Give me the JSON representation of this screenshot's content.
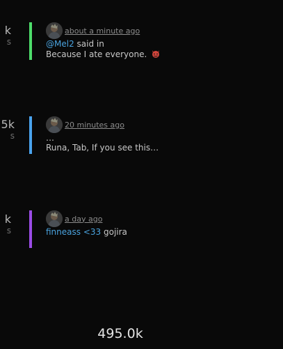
{
  "edge_stats": [
    {
      "value": "k",
      "sub": "s"
    },
    {
      "value": "5k",
      "sub": "s"
    },
    {
      "value": "k",
      "sub": "s"
    }
  ],
  "activities": [
    {
      "accent_color": "#4ddc6a",
      "time": "about a minute ago",
      "mention": "@Mel2",
      "after_mention": "said in",
      "text": "Because I ate everyone.",
      "emoji_icon": "devil-face-icon"
    },
    {
      "accent_color": "#4aa3ee",
      "time": "20 minutes ago",
      "ellipsis": "…",
      "text": "Runa, Tab, If you see this…"
    },
    {
      "accent_color": "#9b4ce6",
      "time": "a day ago",
      "link_text": "finneass <33",
      "text": "gojira"
    }
  ],
  "footer": {
    "total": "495.0k"
  }
}
